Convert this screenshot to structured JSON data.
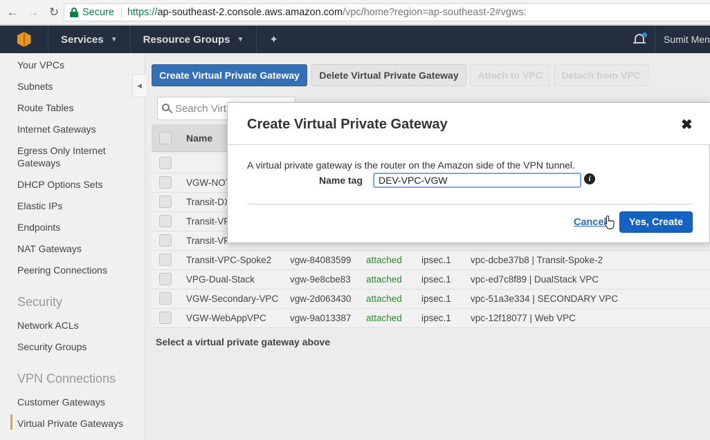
{
  "browser": {
    "secure_label": "Secure",
    "url_scheme": "https://",
    "url_host": "ap-southeast-2.console.aws.amazon.com",
    "url_path": "/vpc/home?region=ap-southeast-2#vgws:"
  },
  "header": {
    "services_label": "Services",
    "resource_groups_label": "Resource Groups",
    "user_label": "Sumit Mena"
  },
  "sidebar": {
    "items": [
      "Your VPCs",
      "Subnets",
      "Route Tables",
      "Internet Gateways",
      "Egress Only Internet Gateways",
      "DHCP Options Sets",
      "Elastic IPs",
      "Endpoints",
      "NAT Gateways",
      "Peering Connections"
    ],
    "security_heading": "Security",
    "security_items": [
      "Network ACLs",
      "Security Groups"
    ],
    "vpn_heading": "VPN Connections",
    "vpn_items": [
      "Customer Gateways",
      "Virtual Private Gateways"
    ]
  },
  "toolbar": {
    "create_label": "Create Virtual Private Gateway",
    "delete_label": "Delete Virtual Private Gateway",
    "attach_label": "Attach to VPC",
    "detach_label": "Detach from VPC"
  },
  "search": {
    "placeholder": "Search Virt"
  },
  "table": {
    "name_header": "Name",
    "rows": [
      {
        "name": "",
        "id": "",
        "state": "",
        "type": "",
        "vpc": ""
      },
      {
        "name": "VGW-NOT",
        "id": "",
        "state": "",
        "type": "",
        "vpc": ""
      },
      {
        "name": "Transit-DX",
        "id": "",
        "state": "",
        "type": "",
        "vpc": ""
      },
      {
        "name": "Transit-VF",
        "id": "",
        "state": "",
        "type": "",
        "vpc": ""
      },
      {
        "name": "Transit-VF",
        "id": "",
        "state": "",
        "type": "",
        "vpc": ""
      },
      {
        "name": "Transit-VPC-Spoke2",
        "id": "vgw-84083599",
        "state": "attached",
        "type": "ipsec.1",
        "vpc": "vpc-dcbe37b8 | Transit-Spoke-2"
      },
      {
        "name": "VPG-Dual-Stack",
        "id": "vgw-9e8cbe83",
        "state": "attached",
        "type": "ipsec.1",
        "vpc": "vpc-ed7c8f89 | DualStack VPC"
      },
      {
        "name": "VGW-Secondary-VPC",
        "id": "vgw-2d063430",
        "state": "attached",
        "type": "ipsec.1",
        "vpc": "vpc-51a3e334 | SECONDARY VPC"
      },
      {
        "name": "VGW-WebAppVPC",
        "id": "vgw-9a013387",
        "state": "attached",
        "type": "ipsec.1",
        "vpc": "vpc-12f18077 | Web VPC"
      }
    ],
    "footer_message": "Select a virtual private gateway above"
  },
  "modal": {
    "title": "Create Virtual Private Gateway",
    "close_glyph": "✖",
    "description": "A virtual private gateway is the router on the Amazon side of the VPN tunnel.",
    "name_tag_label": "Name tag",
    "name_tag_value": "DEV-VPC-VGW",
    "info_glyph": "i",
    "cancel_label": "Cancel",
    "confirm_label": "Yes, Create"
  },
  "colors": {
    "aws_header": "#232f3e",
    "primary_button": "#3470b5",
    "confirm_button": "#1463c2",
    "attached_state": "#2d8c2d",
    "active_marker": "#e8a23b"
  }
}
